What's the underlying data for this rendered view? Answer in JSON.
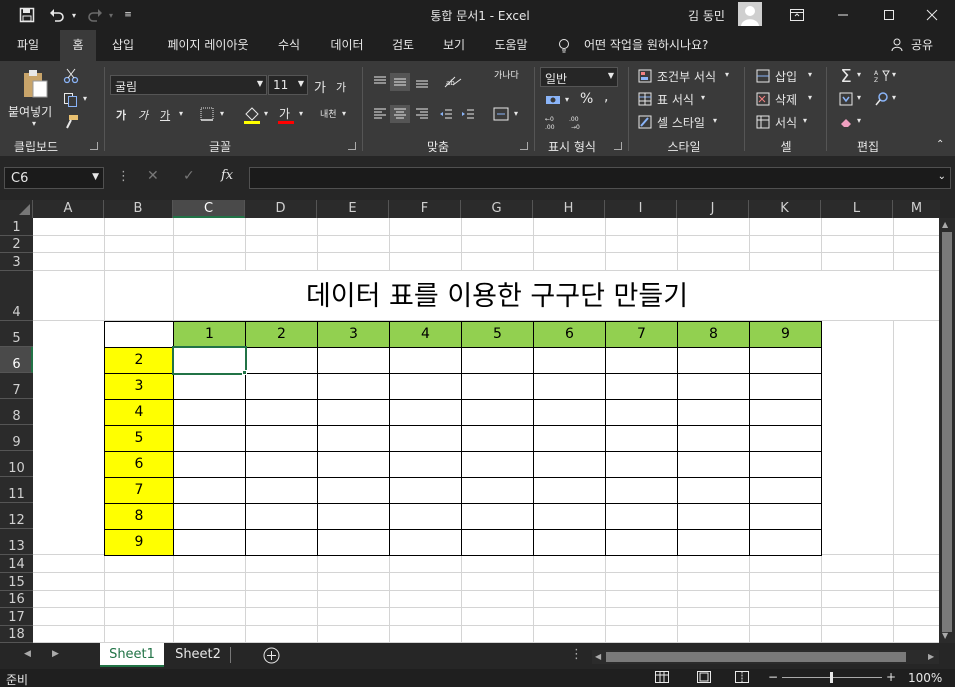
{
  "titlebar": {
    "doc_title": "통합 문서1  -  Excel",
    "user_name": "김 동민",
    "icons": [
      "save-icon",
      "undo-icon",
      "redo-icon",
      "customize-qat-icon",
      "ribbon-display-icon",
      "minimize-icon",
      "maximize-icon",
      "close-icon"
    ]
  },
  "tabs": [
    "파일",
    "홈",
    "삽입",
    "페이지 레이아웃",
    "수식",
    "데이터",
    "검토",
    "보기",
    "도움말"
  ],
  "active_tab": "홈",
  "tell_me": "어떤 작업을 원하시나요?",
  "share": "공유",
  "ribbon": {
    "clipboard": {
      "paste": "붙여넣기",
      "label": "클립보드"
    },
    "font": {
      "name": "굴림",
      "size": "11",
      "grow": "가",
      "shrink": "가",
      "bold": "가",
      "italic": "가",
      "underline": "가",
      "font_color": "가",
      "phonetic": "내천",
      "label": "글꼴"
    },
    "align": {
      "wrap": "가나다",
      "label": "맞춤"
    },
    "number": {
      "format": "일반",
      "percent": "%",
      "comma": ",",
      "dec_inc": ".00→.0",
      "dec_dec": ".00",
      "label": "표시 형식"
    },
    "styles": {
      "conditional": "조건부 서식",
      "table": "표 서식",
      "cell": "셀 스타일",
      "label": "스타일"
    },
    "cells": {
      "insert": "삽입",
      "delete": "삭제",
      "format": "서식",
      "label": "셀"
    },
    "editing": {
      "label": "편집"
    }
  },
  "formula_bar": {
    "name_box": "C6",
    "fx": "fx",
    "value": ""
  },
  "columns": [
    "A",
    "B",
    "C",
    "D",
    "E",
    "F",
    "G",
    "H",
    "I",
    "J",
    "K",
    "L",
    "M"
  ],
  "selected_column": "C",
  "rows": [
    "1",
    "2",
    "3",
    "4",
    "5",
    "6",
    "7",
    "8",
    "9",
    "10",
    "11",
    "12",
    "13",
    "14",
    "15",
    "16",
    "17",
    "18"
  ],
  "selected_row": "6",
  "sheet": {
    "title": "데이터 표를 이용한 구구단 만들기",
    "header_row": [
      "1",
      "2",
      "3",
      "4",
      "5",
      "6",
      "7",
      "8",
      "9"
    ],
    "header_col": [
      "2",
      "3",
      "4",
      "5",
      "6",
      "7",
      "8",
      "9"
    ],
    "header_row_color": "#92d050",
    "header_col_color": "#ffff00"
  },
  "sheet_tabs": [
    "Sheet1",
    "Sheet2"
  ],
  "active_sheet": "Sheet1",
  "status": {
    "ready": "준비",
    "zoom": "100%"
  }
}
